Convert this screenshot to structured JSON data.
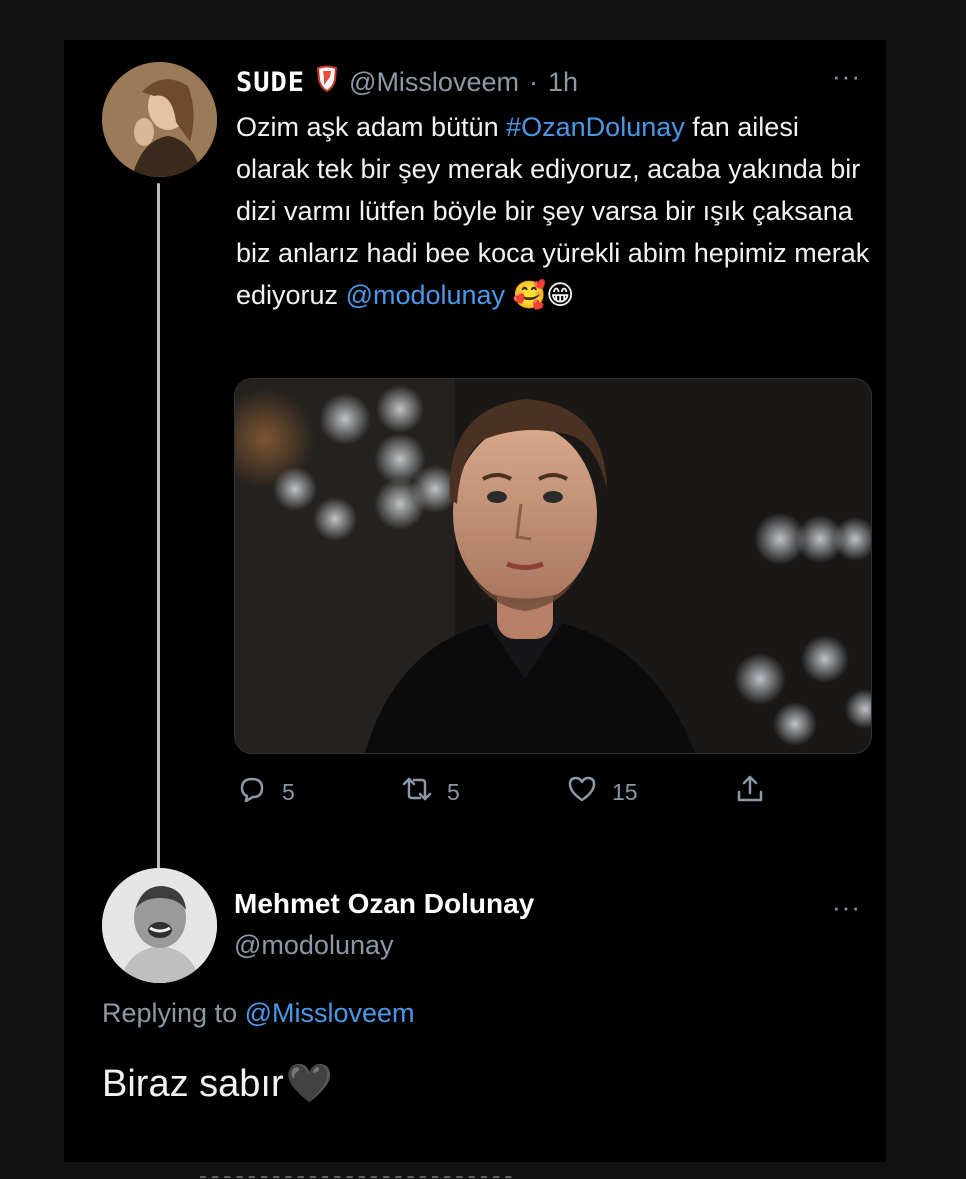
{
  "tweet": {
    "display_name": "SUDE",
    "badge_icon": "shield-emblem-icon",
    "handle": "@Missloveem",
    "separator": "·",
    "time": "1h",
    "text_segments": [
      {
        "text": "Ozim aşk adam bütün ",
        "type": "plain"
      },
      {
        "text": "#OzanDolunay",
        "type": "hashtag"
      },
      {
        "text": " fan ailesi olarak tek bir şey merak ediyoruz, acaba yakında bir dizi varmı lütfen böyle bir şey varsa bir ışık çaksana biz anlarız hadi bee koca yürekli abim hepimiz merak ediyoruz ",
        "type": "plain"
      },
      {
        "text": "@modolunay",
        "type": "mention"
      },
      {
        "text": " 🥰😁",
        "type": "emoji"
      }
    ],
    "media_alt": "photo",
    "actions": {
      "reply_count": "5",
      "retweet_count": "5",
      "like_count": "15"
    },
    "more_label": "···"
  },
  "reply": {
    "display_name": "Mehmet Ozan Dolunay",
    "handle": "@modolunay",
    "replying_prefix": "Replying to",
    "replying_handle": "@Missloveem",
    "text": "Biraz sabır",
    "emoji": "🖤",
    "more_label": "···"
  },
  "colors": {
    "background": "#000000",
    "link": "#4a99e9",
    "muted": "#8b98a5"
  }
}
